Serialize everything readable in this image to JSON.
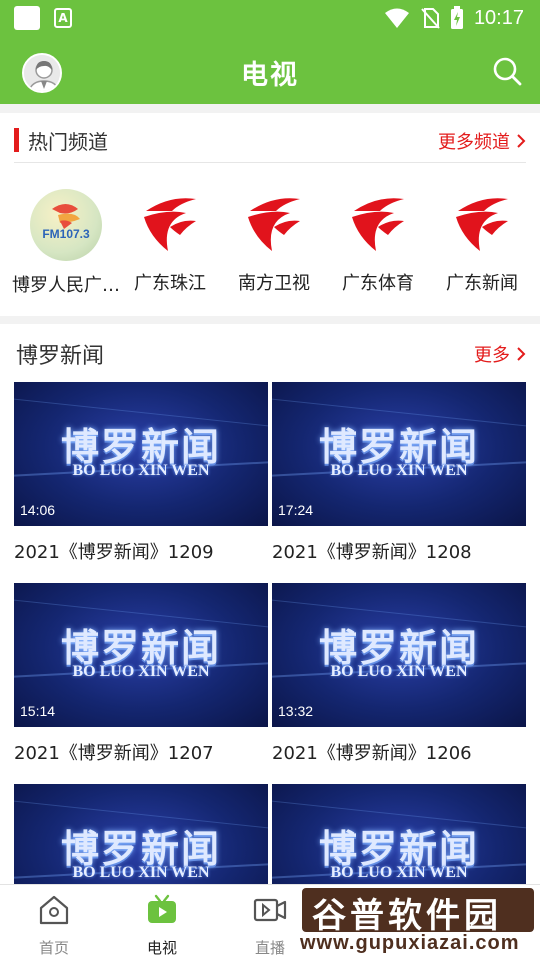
{
  "status_bar": {
    "time": "10:17",
    "app_icon_label": "A"
  },
  "header": {
    "title": "电视"
  },
  "hot_channels": {
    "title": "热门频道",
    "more": "更多频道",
    "items": [
      {
        "name": "博罗人民广…",
        "logo": "fm-radio-logo",
        "logo_text": "FM107.3"
      },
      {
        "name": "广东珠江",
        "logo": "gdtv-logo"
      },
      {
        "name": "南方卫视",
        "logo": "gdtv-logo"
      },
      {
        "name": "广东体育",
        "logo": "gdtv-logo"
      },
      {
        "name": "广东新闻",
        "logo": "gdtv-logo"
      }
    ]
  },
  "news": {
    "title": "博罗新闻",
    "more": "更多",
    "thumb_title": "博罗新闻",
    "thumb_subtitle": "BO LUO XIN WEN",
    "items": [
      {
        "duration": "14:06",
        "caption": "2021《博罗新闻》1209"
      },
      {
        "duration": "17:24",
        "caption": "2021《博罗新闻》1208"
      },
      {
        "duration": "15:14",
        "caption": "2021《博罗新闻》1207"
      },
      {
        "duration": "13:32",
        "caption": "2021《博罗新闻》1206"
      },
      {
        "duration": "",
        "caption": ""
      },
      {
        "duration": "",
        "caption": ""
      }
    ]
  },
  "bottom_nav": [
    {
      "label": "首页",
      "icon": "home-icon",
      "active": false
    },
    {
      "label": "电视",
      "icon": "tv-icon",
      "active": true
    },
    {
      "label": "直播",
      "icon": "live-video-icon",
      "active": false
    }
  ],
  "watermark": {
    "main": "谷普软件园",
    "url": "www.gupuxiazai.com"
  },
  "colors": {
    "brand_green": "#6cc23f",
    "accent_red": "#e31c1c",
    "thumb_blue": "#142670"
  }
}
